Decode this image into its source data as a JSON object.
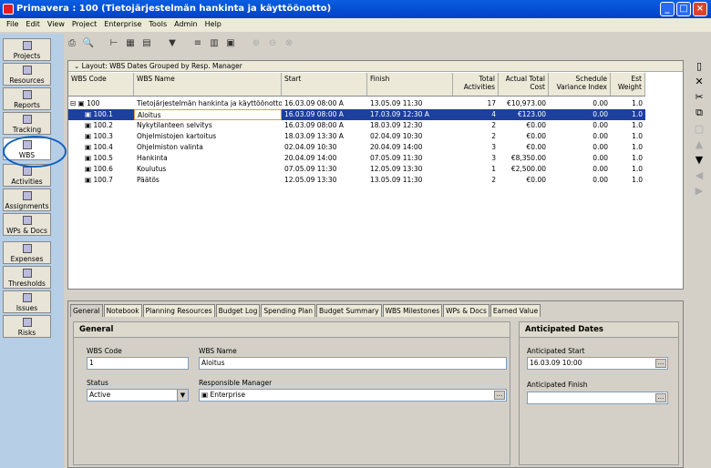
{
  "window": {
    "title": "Primavera : 100 (Tietojärjestelmän hankinta ja käyttöönotto)"
  },
  "menu": [
    "File",
    "Edit",
    "View",
    "Project",
    "Enterprise",
    "Tools",
    "Admin",
    "Help"
  ],
  "nav": [
    "Projects",
    "Resources",
    "Reports",
    "Tracking",
    "WBS",
    "Activities",
    "Assignments",
    "WPs & Docs",
    "Expenses",
    "Thresholds",
    "Issues",
    "Risks"
  ],
  "layout_label": "Layout: WBS Dates Grouped by Resp. Manager",
  "columns": [
    "WBS Code",
    "WBS Name",
    "Start",
    "Finish",
    "Total Activities",
    "Actual Total Cost",
    "Schedule Variance Index",
    "Est Weight"
  ],
  "rows": [
    {
      "code": "100",
      "name": "Tietojärjestelmän hankinta ja käyttöönotto",
      "start": "16.03.09 08:00 A",
      "finish": "13.05.09 11:30",
      "acts": "17",
      "cost": "€10,973.00",
      "svi": "0.00",
      "w": "1.0"
    },
    {
      "code": "100.1",
      "name": "Aloitus",
      "start": "16.03.09 08:00 A",
      "finish": "17.03.09 12:30 A",
      "acts": "4",
      "cost": "€123.00",
      "svi": "0.00",
      "w": "1.0"
    },
    {
      "code": "100.2",
      "name": "Nykytilanteen selvitys",
      "start": "16.03.09 08:00 A",
      "finish": "18.03.09 12:30",
      "acts": "2",
      "cost": "€0.00",
      "svi": "0.00",
      "w": "1.0"
    },
    {
      "code": "100.3",
      "name": "Ohjelmistojen kartoitus",
      "start": "18.03.09 13:30 A",
      "finish": "02.04.09 10:30",
      "acts": "2",
      "cost": "€0.00",
      "svi": "0.00",
      "w": "1.0"
    },
    {
      "code": "100.4",
      "name": "Ohjelmiston valinta",
      "start": "02.04.09 10:30",
      "finish": "20.04.09 14:00",
      "acts": "3",
      "cost": "€0.00",
      "svi": "0.00",
      "w": "1.0"
    },
    {
      "code": "100.5",
      "name": "Hankinta",
      "start": "20.04.09 14:00",
      "finish": "07.05.09 11:30",
      "acts": "3",
      "cost": "€8,350.00",
      "svi": "0.00",
      "w": "1.0"
    },
    {
      "code": "100.6",
      "name": "Koulutus",
      "start": "07.05.09 11:30",
      "finish": "12.05.09 13:30",
      "acts": "1",
      "cost": "€2,500.00",
      "svi": "0.00",
      "w": "1.0"
    },
    {
      "code": "100.7",
      "name": "Päätös",
      "start": "12.05.09 13:30",
      "finish": "13.05.09 11:30",
      "acts": "2",
      "cost": "€0.00",
      "svi": "0.00",
      "w": "1.0"
    }
  ],
  "tabs": [
    "General",
    "Notebook",
    "Planning Resources",
    "Budget Log",
    "Spending Plan",
    "Budget Summary",
    "WBS Milestones",
    "WPs & Docs",
    "Earned Value"
  ],
  "general": {
    "title": "General",
    "wbs_code_label": "WBS Code",
    "wbs_code": "1",
    "wbs_name_label": "WBS Name",
    "wbs_name": "Aloitus",
    "status_label": "Status",
    "status": "Active",
    "manager_label": "Responsible Manager",
    "manager": "Enterprise"
  },
  "anticipated": {
    "title": "Anticipated Dates",
    "start_label": "Anticipated Start",
    "start": "16.03.09 10:00",
    "finish_label": "Anticipated Finish",
    "finish": ""
  }
}
